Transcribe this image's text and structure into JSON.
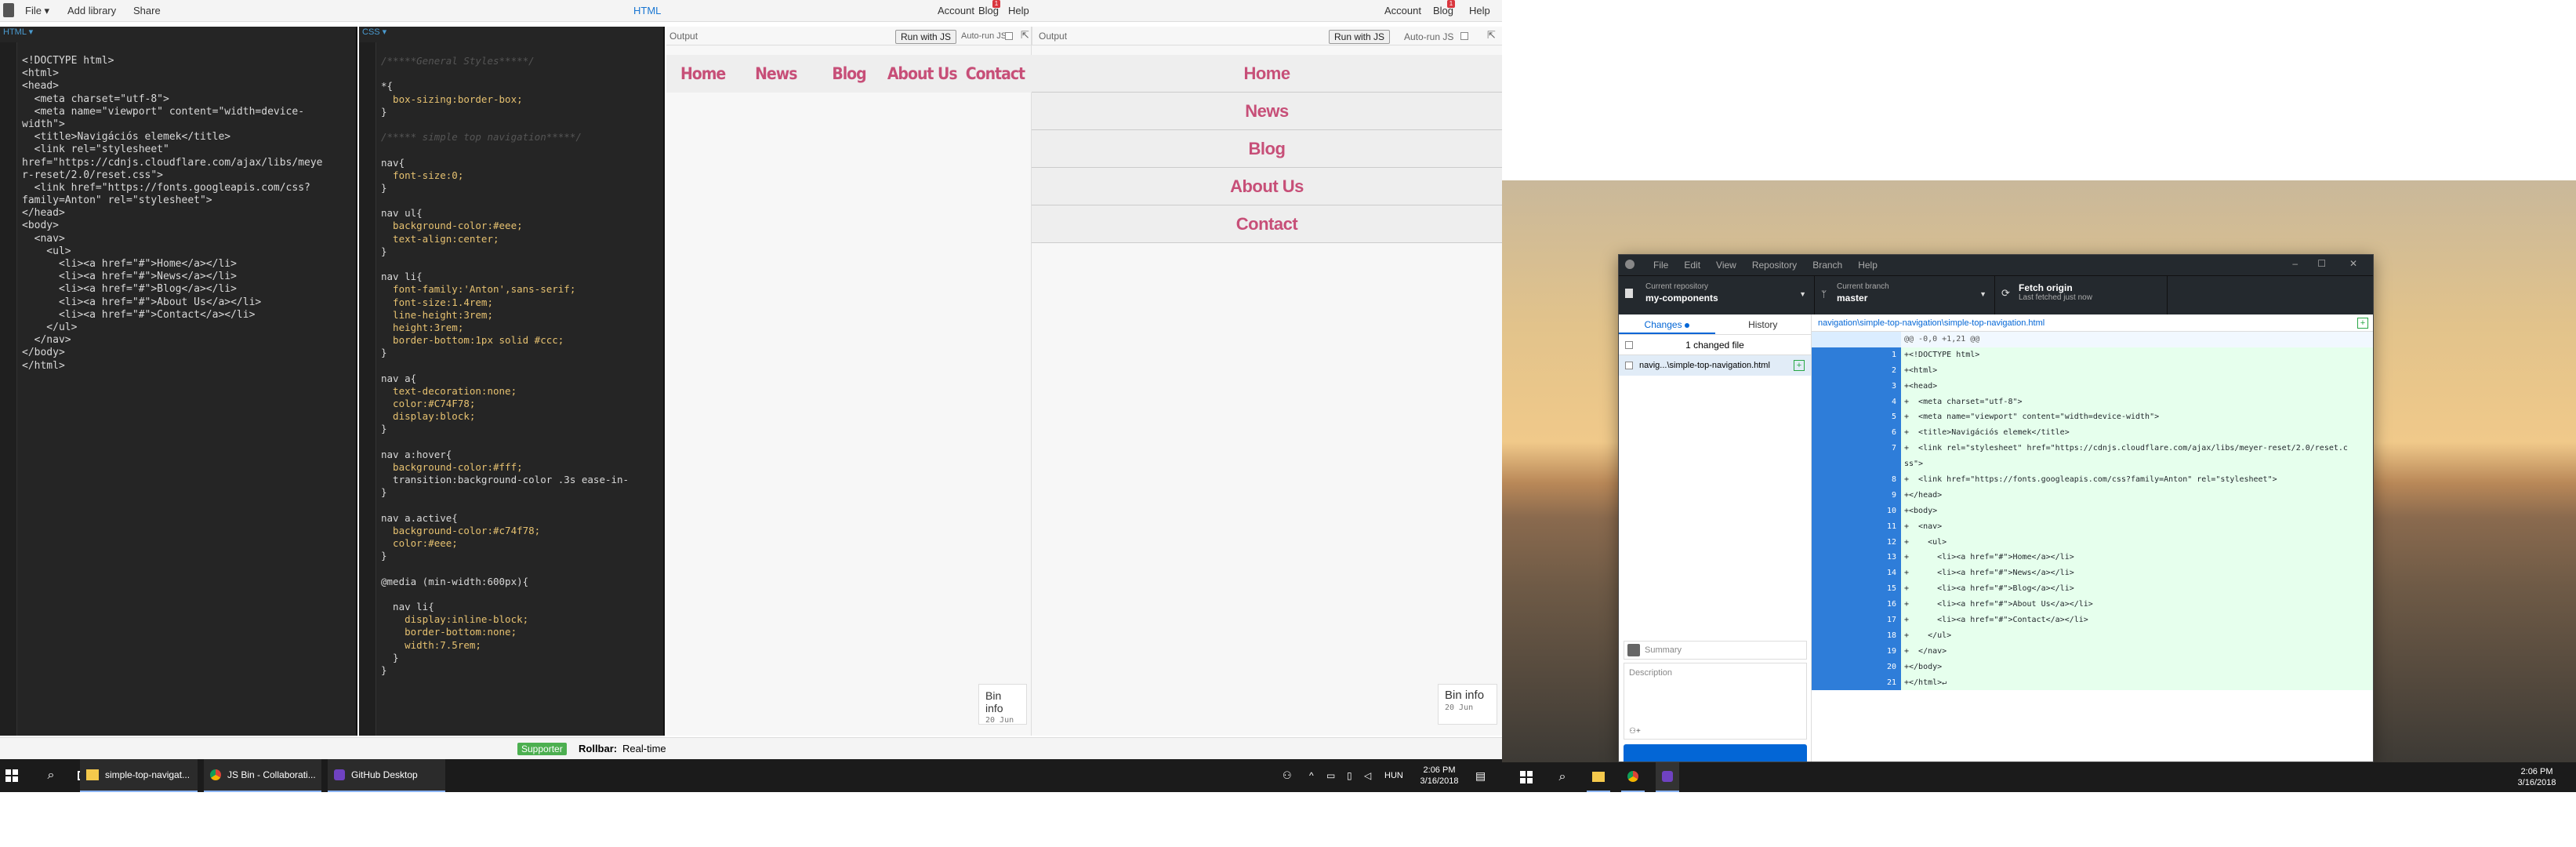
{
  "left_screen": {
    "menu": {
      "file": "File ▾",
      "add_library": "Add library",
      "share": "Share",
      "center_label": "HTML",
      "account": "Account",
      "blog": "Blog",
      "help": "Help",
      "right_account": "Account",
      "right_blog": "Blog",
      "right_help": "Help",
      "badge": "1"
    },
    "html_pane": {
      "label": "HTML ▾",
      "code_lines": [
        "<!DOCTYPE html>",
        "<html>",
        "<head>",
        "  <meta charset=\"utf-8\">",
        "  <meta name=\"viewport\" content=\"width=device-",
        "width\">",
        "  <title>Navigációs elemek</title>",
        "  <link rel=\"stylesheet\"",
        "href=\"https://cdnjs.cloudflare.com/ajax/libs/meye",
        "r-reset/2.0/reset.css\">",
        "  <link href=\"https://fonts.googleapis.com/css?",
        "family=Anton\" rel=\"stylesheet\">",
        "</head>",
        "<body>",
        "  <nav>",
        "    <ul>",
        "      <li><a href=\"#\">Home</a></li>",
        "      <li><a href=\"#\">News</a></li>",
        "      <li><a href=\"#\">Blog</a></li>",
        "      <li><a href=\"#\">About Us</a></li>",
        "      <li><a href=\"#\">Contact</a></li>",
        "    </ul>",
        "  </nav>",
        "</body>",
        "</html>"
      ]
    },
    "css_pane": {
      "label": "CSS ▾",
      "code_lines": [
        "/*****General Styles*****/",
        "",
        "*{",
        "  box-sizing:border-box;",
        "}",
        "",
        "/***** simple top navigation*****/",
        "",
        "nav{",
        "  font-size:0;",
        "}",
        "",
        "nav ul{",
        "  background-color:#eee;",
        "  text-align:center;",
        "}",
        "",
        "nav li{",
        "  font-family:'Anton',sans-serif;",
        "  font-size:1.4rem;",
        "  line-height:3rem;",
        "  height:3rem;",
        "  border-bottom:1px solid #ccc;",
        "}",
        "",
        "nav a{",
        "  text-decoration:none;",
        "  color:#C74F78;",
        "  display:block;",
        "}",
        "",
        "nav a:hover{",
        "  background-color:#fff;",
        "  transition:background-color .3s ease-in-",
        "}",
        "",
        "nav a.active{",
        "  background-color:#c74f78;",
        "  color:#eee;",
        "}",
        "",
        "@media (min-width:600px){",
        "",
        "  nav li{",
        "    display:inline-block;",
        "    border-bottom:none;",
        "    width:7.5rem;",
        "  }",
        "}"
      ]
    },
    "output1": {
      "label": "Output",
      "run_button": "Run with JS",
      "autorun": "Auto-run JS",
      "nav": [
        "Home",
        "News",
        "Blog",
        "About Us",
        "Contact"
      ],
      "bin_info": "Bin info",
      "bin_date": "20 Jun"
    },
    "output2": {
      "label": "Output",
      "run_button": "Run with JS",
      "autorun": "Auto-run JS",
      "nav": [
        "Home",
        "News",
        "Blog",
        "About Us",
        "Contact"
      ],
      "bin_info": "Bin info",
      "bin_date": "20 Jun"
    },
    "status": {
      "supporter": "Supporter",
      "rollbar": "Rollbar:",
      "rollbar_text": "Real-time"
    },
    "taskbar": {
      "apps": [
        "simple-top-navigat...",
        "JS Bin - Collaborati...",
        "GitHub Desktop"
      ],
      "lang": "HUN",
      "time": "2:06 PM",
      "date": "3/16/2018"
    }
  },
  "right_screen": {
    "github": {
      "menu": [
        "File",
        "Edit",
        "View",
        "Repository",
        "Branch",
        "Help"
      ],
      "repo_label": "Current repository",
      "repo_name": "my-components",
      "branch_label": "Current branch",
      "branch_name": "master",
      "fetch_label": "Fetch origin",
      "fetch_sub": "Last fetched just now",
      "tab_changes": "Changes",
      "tab_history": "History",
      "changed_count": "1 changed file",
      "file_name": "navig...\\simple-top-navigation.html",
      "summary_placeholder": "Summary",
      "description_placeholder": "Description",
      "path": "navigation\\simple-top-navigation\\simple-top-navigation.html",
      "hunk": "@@ -0,0 +1,21 @@",
      "diff": [
        {
          "n": "1",
          "t": "+﻿<!DOCTYPE html>"
        },
        {
          "n": "2",
          "t": "+<html>"
        },
        {
          "n": "3",
          "t": "+<head>"
        },
        {
          "n": "4",
          "t": "+  <meta charset=\"utf-8\">"
        },
        {
          "n": "5",
          "t": "+  <meta name=\"viewport\" content=\"width=device-width\">"
        },
        {
          "n": "6",
          "t": "+  <title>Navigációs elemek</title>"
        },
        {
          "n": "7",
          "t": "+  <link rel=\"stylesheet\" href=\"https://cdnjs.cloudflare.com/ajax/libs/meyer-reset/2.0/reset.c"
        },
        {
          "n": "",
          "t": "ss\">"
        },
        {
          "n": "8",
          "t": "+  <link href=\"https://fonts.googleapis.com/css?family=Anton\" rel=\"stylesheet\">"
        },
        {
          "n": "9",
          "t": "+</head>"
        },
        {
          "n": "10",
          "t": "+<body>"
        },
        {
          "n": "11",
          "t": "+  <nav>"
        },
        {
          "n": "12",
          "t": "+    <ul>"
        },
        {
          "n": "13",
          "t": "+      <li><a href=\"#\">Home</a></li>"
        },
        {
          "n": "14",
          "t": "+      <li><a href=\"#\">News</a></li>"
        },
        {
          "n": "15",
          "t": "+      <li><a href=\"#\">Blog</a></li>"
        },
        {
          "n": "16",
          "t": "+      <li><a href=\"#\">About Us</a></li>"
        },
        {
          "n": "17",
          "t": "+      <li><a href=\"#\">Contact</a></li>"
        },
        {
          "n": "18",
          "t": "+    </ul>"
        },
        {
          "n": "19",
          "t": "+  </nav>"
        },
        {
          "n": "20",
          "t": "+</body>"
        },
        {
          "n": "21",
          "t": "+</html>↵"
        }
      ]
    },
    "taskbar": {
      "time": "2:06 PM",
      "date": "3/16/2018"
    }
  },
  "colors": {
    "nav_link": "#C74F78",
    "diff_gutter": "#2E7DD9",
    "diff_add": "#E6FFED",
    "supporter_badge": "#4CAF50"
  }
}
